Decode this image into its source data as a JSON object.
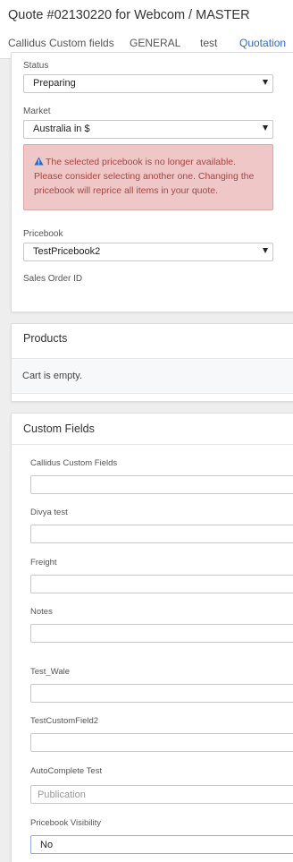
{
  "header": {
    "title": "Quote #02130220 for Webcom / MASTER",
    "tabs": [
      "Callidus Custom fields",
      "GENERAL",
      "test",
      "Quotation"
    ],
    "active_tab": "Quotation"
  },
  "general": {
    "status_label": "Status",
    "status_value": "Preparing",
    "market_label": "Market",
    "market_value": "Australia in $",
    "alert_text": "The selected pricebook is no longer available. Please consider selecting another one. Changing the pricebook will reprice all items in your quote.",
    "pricebook_label": "Pricebook",
    "pricebook_value": "TestPricebook2",
    "sales_order_label": "Sales Order ID"
  },
  "products": {
    "title": "Products",
    "empty_text": "Cart is empty."
  },
  "custom_fields": {
    "title": "Custom Fields",
    "fields": [
      {
        "label": "Callidus Custom Fields",
        "value": ""
      },
      {
        "label": "Divya test",
        "value": ""
      },
      {
        "label": "Freight",
        "value": ""
      },
      {
        "label": "Notes",
        "value": ""
      },
      {
        "label": "Test_Wale",
        "value": ""
      },
      {
        "label": "TestCustomField2",
        "value": ""
      },
      {
        "label": "AutoComplete Test",
        "value": "",
        "placeholder": "Publication"
      },
      {
        "label": "Pricebook Visibility",
        "value": "No"
      }
    ]
  },
  "colors": {
    "accent": "#2d6cc4",
    "alert_bg": "#efc7c7",
    "alert_text": "#a94442",
    "page_bg": "#eeeeee"
  }
}
